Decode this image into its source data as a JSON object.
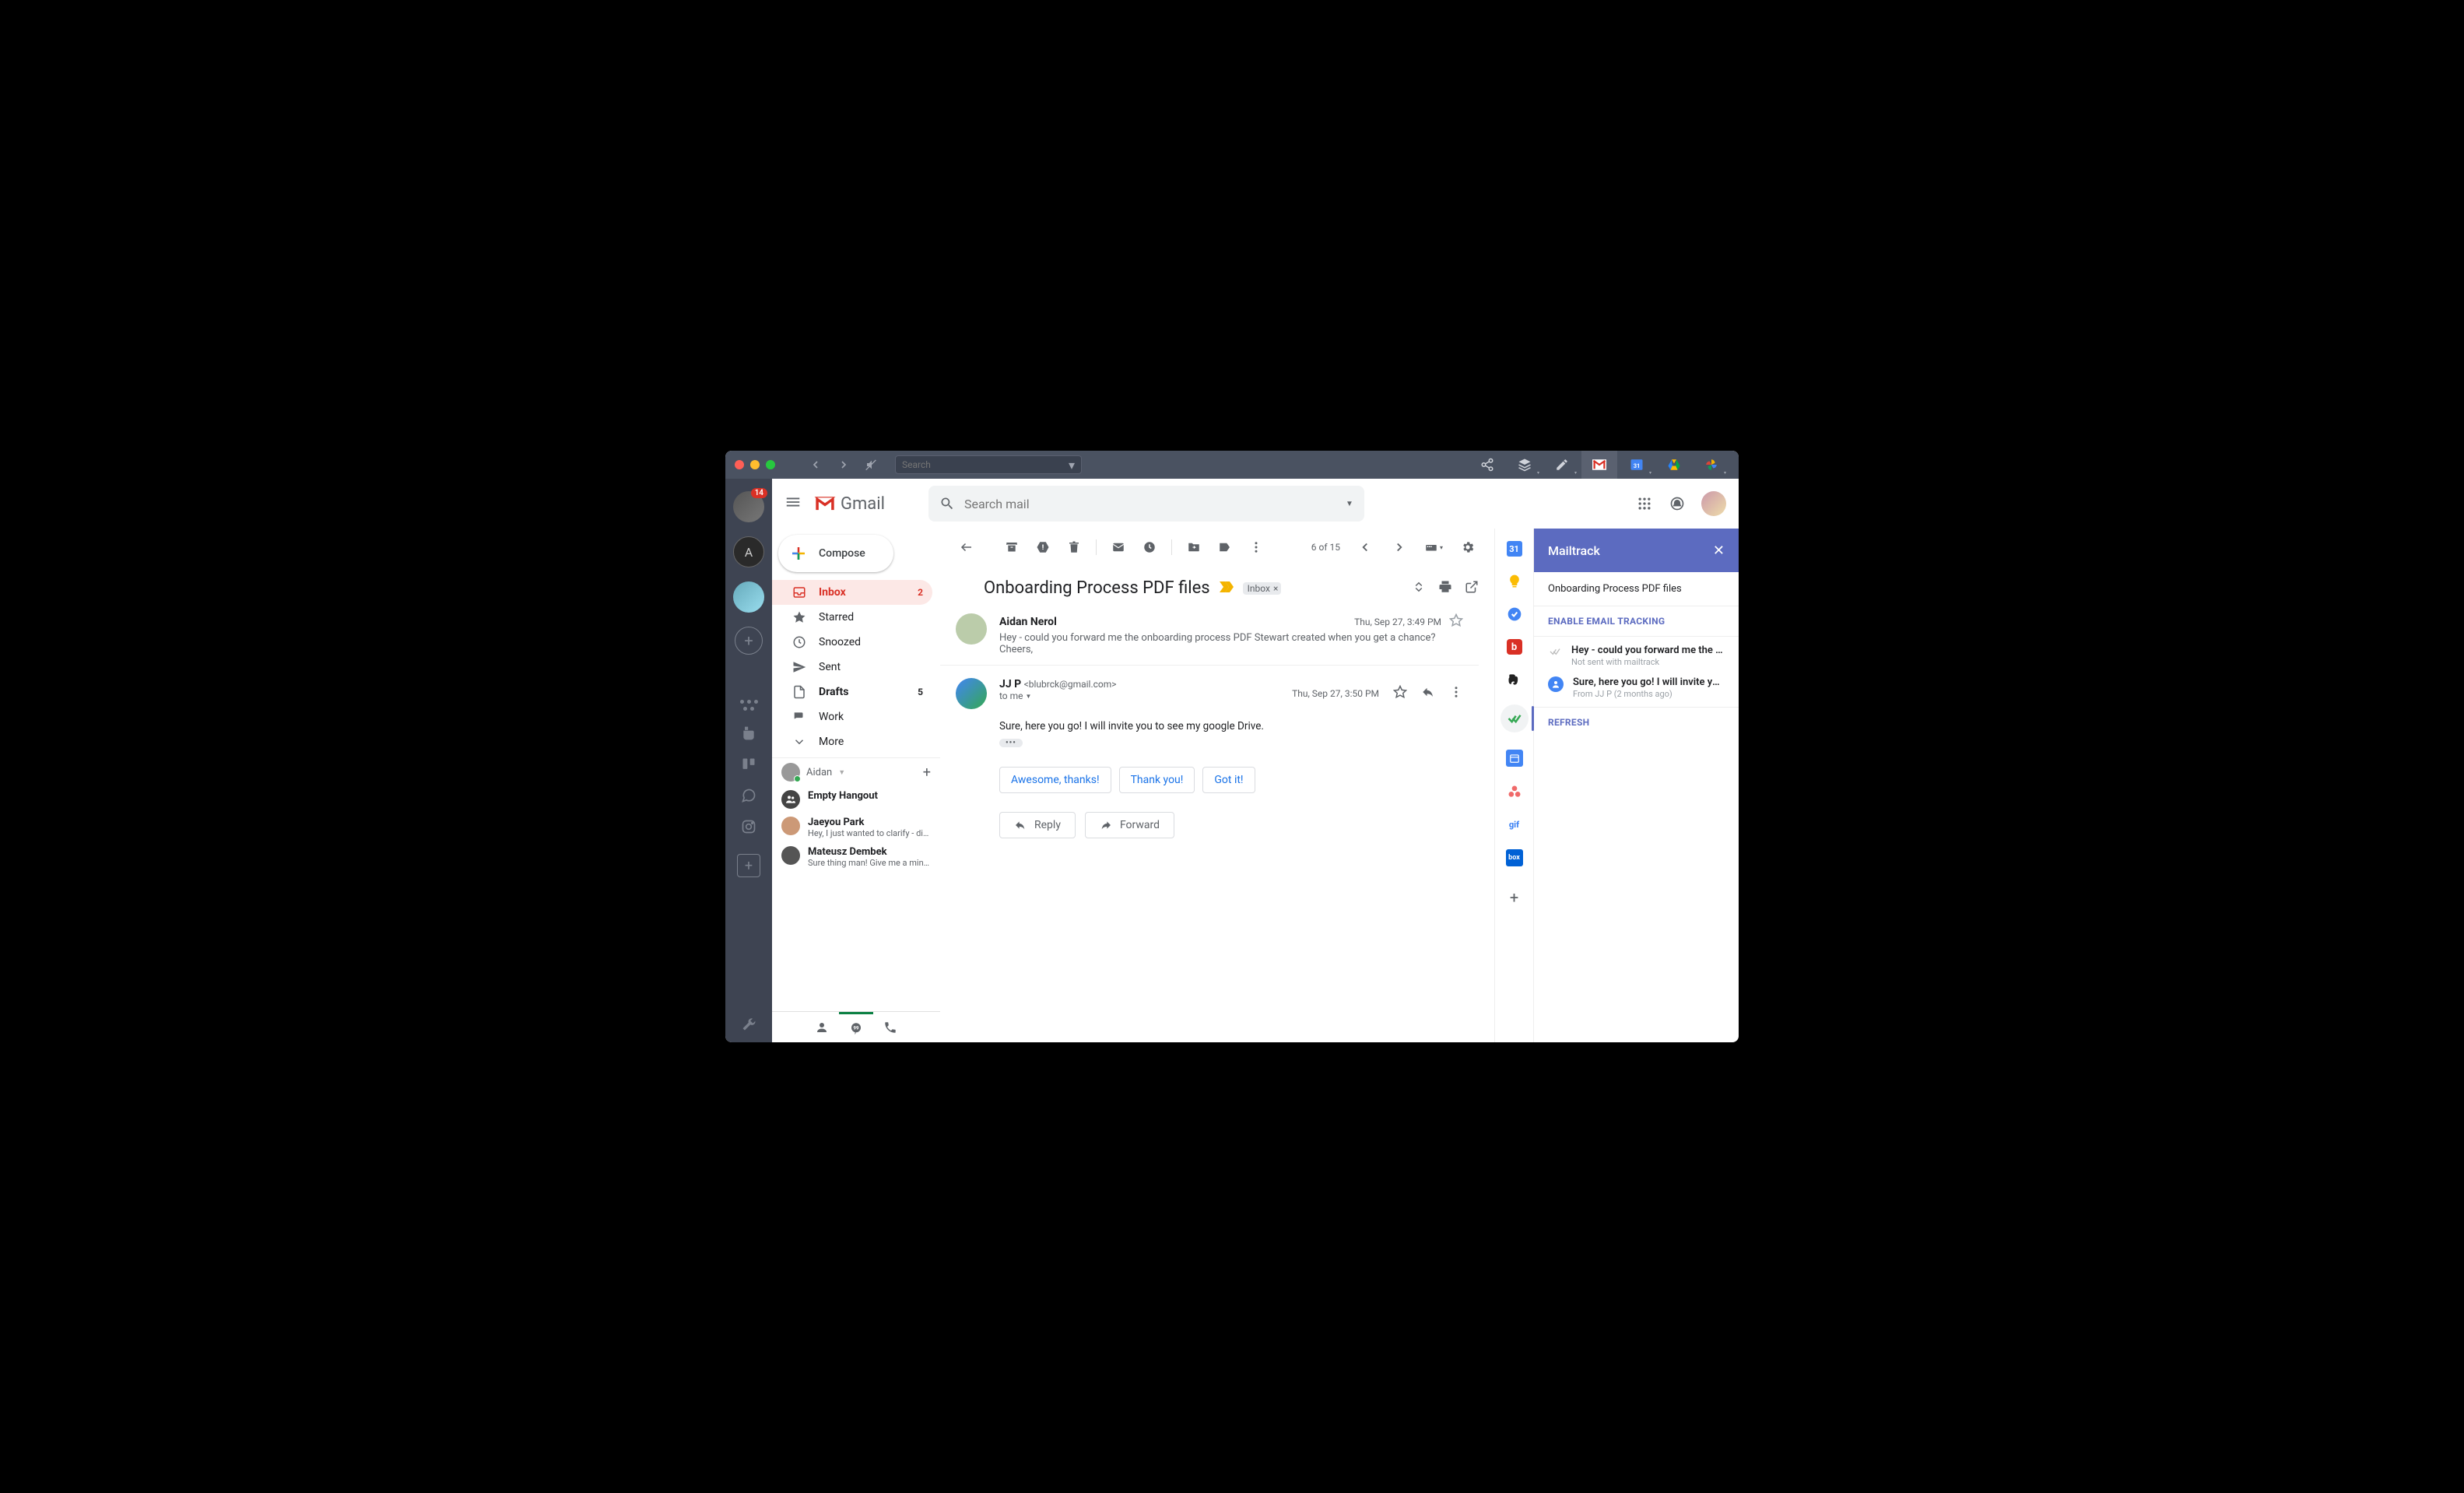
{
  "chrome": {
    "search_placeholder": "Search",
    "badge": "14"
  },
  "gmail": {
    "brand": "Gmail",
    "search_placeholder": "Search mail",
    "compose": "Compose",
    "nav": {
      "inbox": {
        "label": "Inbox",
        "count": "2"
      },
      "starred": {
        "label": "Starred"
      },
      "snoozed": {
        "label": "Snoozed"
      },
      "sent": {
        "label": "Sent"
      },
      "drafts": {
        "label": "Drafts",
        "count": "5"
      },
      "work": {
        "label": "Work"
      },
      "more": {
        "label": "More"
      }
    },
    "toolbar": {
      "counter": "6 of 15"
    },
    "subject": "Onboarding Process PDF files",
    "inbox_chip": "Inbox",
    "messages": {
      "m1": {
        "sender": "Aidan Nerol",
        "date": "Thu, Sep 27, 3:49 PM",
        "snippet": "Hey - could you forward me the onboarding process PDF Stewart created when you get a chance? Cheers,"
      },
      "m2": {
        "sender": "JJ P",
        "email": "<blubrck@gmail.com>",
        "to": "to me",
        "date": "Thu, Sep 27, 3:50 PM",
        "body": "Sure, here you go! I will invite you to see my google Drive."
      }
    },
    "smart_replies": [
      "Awesome, thanks!",
      "Thank you!",
      "Got it!"
    ],
    "reply": "Reply",
    "forward": "Forward"
  },
  "hangouts": {
    "user": "Aidan",
    "items": [
      {
        "name": "Empty Hangout",
        "msg": ""
      },
      {
        "name": "Jaeyou Park",
        "msg": "Hey, I just wanted to clarify - did yo"
      },
      {
        "name": "Mateusz Dembek",
        "msg": "Sure thing man! Give me a minute."
      }
    ]
  },
  "mailtrack": {
    "title": "Mailtrack",
    "subject": "Onboarding Process PDF files",
    "enable": "ENABLE EMAIL TRACKING",
    "items": [
      {
        "t1": "Hey - could you forward me the on...",
        "t2": "Not sent with mailtrack"
      },
      {
        "t1": "Sure, here you go! I will invite yo...",
        "t2": "From JJ P (2 months ago)"
      }
    ],
    "refresh": "REFRESH"
  },
  "addons": {
    "cal_day": "31",
    "box": "box",
    "gif": "gif"
  }
}
